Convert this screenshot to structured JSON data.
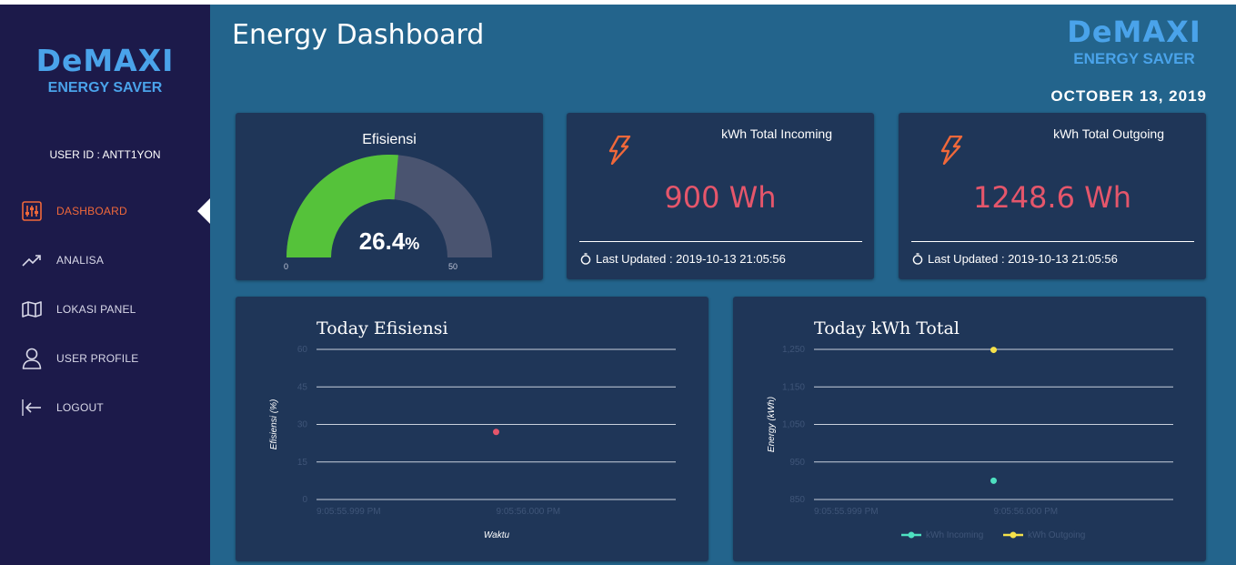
{
  "sidebar": {
    "brand": {
      "name": "DeMAXI",
      "tagline": "ENERGY SAVER"
    },
    "user_id": "USER ID : ANTT1YON",
    "items": [
      {
        "label": "DASHBOARD",
        "icon": "sliders-icon",
        "active": true
      },
      {
        "label": "ANALISA",
        "icon": "trend-icon",
        "active": false
      },
      {
        "label": "LOKASI PANEL",
        "icon": "map-icon",
        "active": false
      },
      {
        "label": "USER PROFILE",
        "icon": "user-icon",
        "active": false
      },
      {
        "label": "LOGOUT",
        "icon": "logout-icon",
        "active": false
      }
    ]
  },
  "header": {
    "title": "Energy Dashboard",
    "brand": {
      "name": "DeMAXI",
      "tagline": "ENERGY SAVER"
    },
    "date": "OCTOBER 13, 2019"
  },
  "gauge": {
    "title": "Efisiensi",
    "value": 26.4,
    "value_text": "26.4",
    "unit": "%",
    "min": 0,
    "max": 50,
    "min_label": "0",
    "max_label": "50"
  },
  "incoming": {
    "title": "kWh Total Incoming",
    "value": "900 Wh",
    "updated": "Last Updated : 2019-10-13 21:05:56"
  },
  "outgoing": {
    "title": "kWh Total Outgoing",
    "value": "1248.6 Wh",
    "updated": "Last Updated : 2019-10-13 21:05:56"
  },
  "colors": {
    "sidebar": "#1c1a4a",
    "main": "#23648c",
    "card": "#1f3658",
    "accent_orange": "#f0683a",
    "value_red": "#e5566b",
    "gauge_green": "#55c23a",
    "gauge_track": "#4a5470"
  },
  "chart_data": [
    {
      "type": "scatter",
      "title": "Today Efisiensi",
      "xlabel": "Waktu",
      "ylabel": "Efisiensi (%)",
      "ylim": [
        0,
        60
      ],
      "yticks": [
        "0",
        "15",
        "30",
        "45",
        "60"
      ],
      "xticks": [
        "9:05:55.999 PM",
        "9:05:56.000 PM"
      ],
      "grid": true,
      "series": [
        {
          "color": "#e5566b",
          "points": [
            {
              "x": "9:05:56.000 PM",
              "y": 27
            }
          ]
        }
      ]
    },
    {
      "type": "scatter",
      "title": "Today kWh Total",
      "xlabel": "",
      "ylabel": "Energy (kWh)",
      "ylim": [
        850,
        1250
      ],
      "yticks": [
        "850",
        "950",
        "1,050",
        "1,150",
        "1,250"
      ],
      "xticks": [
        "9:05:55.999 PM",
        "9:05:56.000 PM"
      ],
      "grid": true,
      "legend": "bottom",
      "series": [
        {
          "name": "kWh Incoming",
          "color": "#4ee0c0",
          "points": [
            {
              "x": "9:05:56.000 PM",
              "y": 900
            }
          ]
        },
        {
          "name": "kWh Outgoing",
          "color": "#f5e14a",
          "points": [
            {
              "x": "9:05:56.000 PM",
              "y": 1248.6
            }
          ]
        }
      ]
    }
  ]
}
